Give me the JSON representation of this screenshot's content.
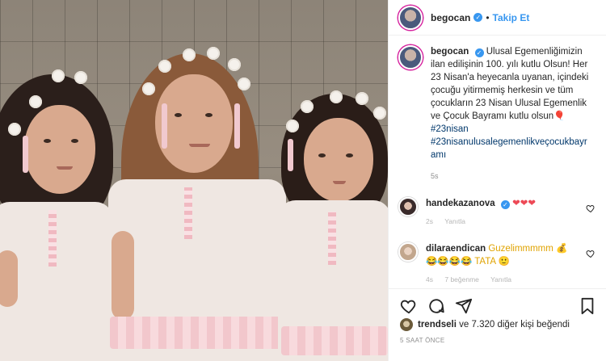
{
  "post": {
    "username": "begocan",
    "follow_label": "Takip Et",
    "separator": "•",
    "caption_text": "Ulusal Egemenliğimizin ilan edilişinin 100. yılı kutlu Olsun! Her 23 Nisan'a heyecanla uyanan, içindeki çocuğu yitirmemiş herkesin ve tüm çocukların 23 Nisan Ulusal Egemenlik ve Çocuk Bayramı kutlu olsun🎈",
    "hashtags": [
      "#23nisan",
      "#23nisanulusalegemenlikveçocukbayr amı"
    ],
    "caption_age": "5s",
    "likes_user": "trendseli",
    "likes_rest": "ve 7.320 diğer kişi beğendi",
    "timestamp": "5 SAAT ÖNCE"
  },
  "comments": [
    {
      "username": "handekazanova",
      "text": "❤❤❤",
      "age": "2s",
      "reply_label": "Yanıtla",
      "likes_label": ""
    },
    {
      "username": "dilaraendican",
      "text": "Guzelimmmmm 💰 😂😂😂😂 TATA 🙂",
      "age": "4s",
      "likes_label": "7 beğenme",
      "reply_label": "Yanıtla"
    }
  ],
  "icons": {
    "verified": "verified-badge-icon",
    "like": "heart-icon",
    "comment": "comment-icon",
    "share": "share-icon",
    "save": "bookmark-icon"
  },
  "colors": {
    "link": "#3897f0",
    "hashtag": "#00376b",
    "muted": "#8e8e8e"
  }
}
